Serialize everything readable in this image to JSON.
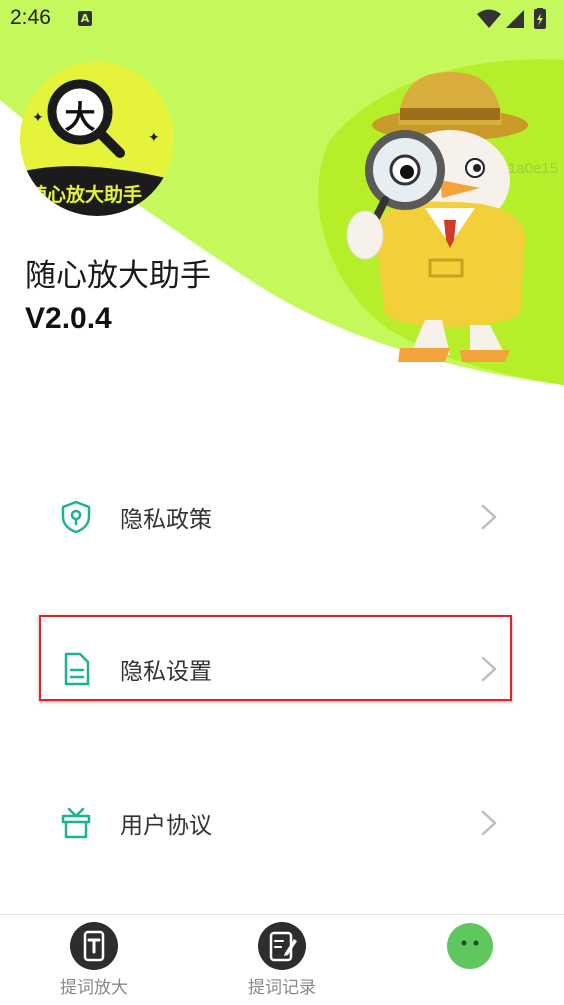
{
  "status_bar": {
    "time": "2:46",
    "notification_letter": "A"
  },
  "app": {
    "logo_char": "大",
    "logo_banner": "随心放大助手",
    "name": "随心放大助手",
    "version": "V2.0.4",
    "watermark": "1a0e15"
  },
  "menu": [
    {
      "label": "隐私政策",
      "icon": "shield-icon"
    },
    {
      "label": "隐私设置",
      "icon": "document-icon"
    },
    {
      "label": "用户协议",
      "icon": "gift-icon"
    }
  ],
  "tabs": [
    {
      "label": "提词放大",
      "icon": "text-phone-icon"
    },
    {
      "label": "提词记录",
      "icon": "edit-record-icon"
    },
    {
      "label": "",
      "icon": "chat-icon"
    }
  ],
  "colors": {
    "accent": "#c5f85a",
    "accent_green": "#5ec85f",
    "teal_icon": "#19b394",
    "highlight": "#d8262b"
  }
}
